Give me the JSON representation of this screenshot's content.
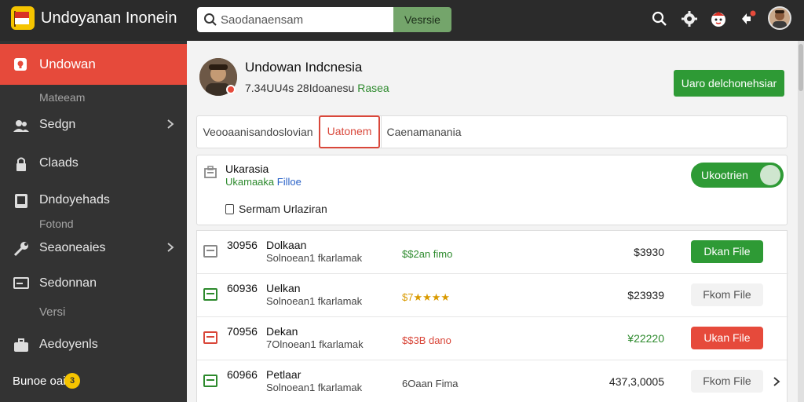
{
  "app": {
    "title": "Undoyanan Inonein"
  },
  "search": {
    "placeholder": "Saodanaensam",
    "button_label": "Vesrsie"
  },
  "topbar_icons": [
    "search-icon",
    "settings-icon",
    "mascot-icon",
    "notification-icon",
    "user-avatar"
  ],
  "sidebar": {
    "active": {
      "label": "Undowan",
      "icon": "home-icon"
    },
    "items": [
      {
        "label": "Sedgn",
        "icon": "users-icon",
        "chevron": true
      },
      {
        "label": "Claads",
        "icon": "lock-icon",
        "chevron": false
      },
      {
        "label": "Dndoyehads",
        "icon": "tablet-icon",
        "chevron": false
      },
      {
        "label": "Seaoneaies",
        "icon": "tools-icon",
        "chevron": true
      },
      {
        "label": "Sedonnan",
        "icon": "monitor-icon",
        "chevron": false
      },
      {
        "label": "Aedoyenls",
        "icon": "briefcase-icon",
        "chevron": false
      }
    ],
    "subs": {
      "s1": "Mateeam",
      "s2": "Fotond",
      "s3": "Versi"
    },
    "footer": {
      "text": "Bunoe oai",
      "badge": "3"
    }
  },
  "profile": {
    "name": "Undowan Indcnesia",
    "meta_prefix": "7.34UU4s 28Idoanesu",
    "meta_green": "Rasea",
    "primary_button": "Uaro delchonehsiar"
  },
  "tabs": [
    {
      "label": "Veooaanisandoslovian",
      "active": false
    },
    {
      "label": "Uatonem",
      "active": true
    },
    {
      "label": "Caenamanania",
      "active": false
    }
  ],
  "card": {
    "title": "Ukarasia",
    "sub_green": "Ukamaaka",
    "sub_blue": "Filloe",
    "toggle_label": "Ukootrien",
    "checkbox_label": "Sermam Urlaziran"
  },
  "rows": [
    {
      "num": "30956",
      "name": "Dolkaan",
      "desc": "Solnoean1 fkarlamak",
      "status": "$$2an fimo",
      "status_color": "#2d8a2d",
      "price": "$3930",
      "price_color": "#222",
      "button": "Dkan File",
      "button_style": "green",
      "icon_color": "#888"
    },
    {
      "num": "60936",
      "name": "Uelkan",
      "desc": "Solnoean1 fkarlamak",
      "status": "$7★★★★",
      "status_color": "#d99a00",
      "price": "$23939",
      "price_color": "#222",
      "button": "Fkom File",
      "button_style": "plain",
      "icon_color": "#2d8a2d"
    },
    {
      "num": "70956",
      "name": "Dekan",
      "desc": "7Olnoean1 fkarlamak",
      "status": "$$3B dano",
      "status_color": "#d9473a",
      "price": "¥22220",
      "price_color": "#2d8a2d",
      "button": "Ukan File",
      "button_style": "red",
      "icon_color": "#d9473a"
    },
    {
      "num": "60966",
      "name": "Petlaar",
      "desc": "Solnoean1 fkarlamak",
      "status": "6Oaan Fima",
      "status_color": "#444",
      "price": "437,3,0005",
      "price_color": "#222",
      "button": "Fkom File",
      "button_style": "plain",
      "icon_color": "#2d8a2d"
    }
  ],
  "colors": {
    "accent_red": "#e64a3b",
    "accent_green": "#2e9a35",
    "sidebar_bg": "#333333",
    "topbar_bg": "#2b2b2b"
  }
}
